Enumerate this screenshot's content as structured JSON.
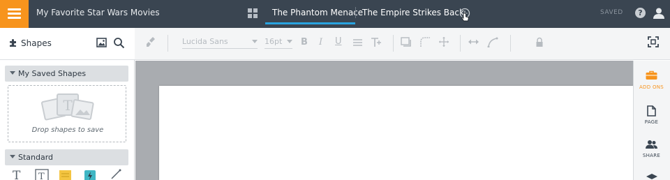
{
  "app": {
    "document_title": "My Favorite Star Wars Movies",
    "save_status": "SAVED"
  },
  "tabs": [
    {
      "label": "The Phantom Menace",
      "active": true
    },
    {
      "label": "The Empire Strikes Back",
      "active": false
    }
  ],
  "left_panel": {
    "title": "Shapes",
    "sections": [
      {
        "label": "My Saved Shapes",
        "drop_hint": "Drop shapes to save"
      },
      {
        "label": "Standard"
      }
    ]
  },
  "toolbar": {
    "font_family": "Lucida Sans",
    "font_size": "16pt"
  },
  "right_rail": {
    "items": [
      {
        "label": "ADD ONS",
        "icon": "briefcase-icon",
        "color": "#f7941d"
      },
      {
        "label": "PAGE",
        "icon": "page-icon",
        "color": "#3a4551"
      },
      {
        "label": "SHARE",
        "icon": "people-icon",
        "color": "#3a4551"
      }
    ]
  },
  "colors": {
    "topbar": "#3a4551",
    "accent_orange": "#f7941d",
    "tab_underline": "#29a3e0",
    "canvas_bg": "#a9acb0"
  }
}
